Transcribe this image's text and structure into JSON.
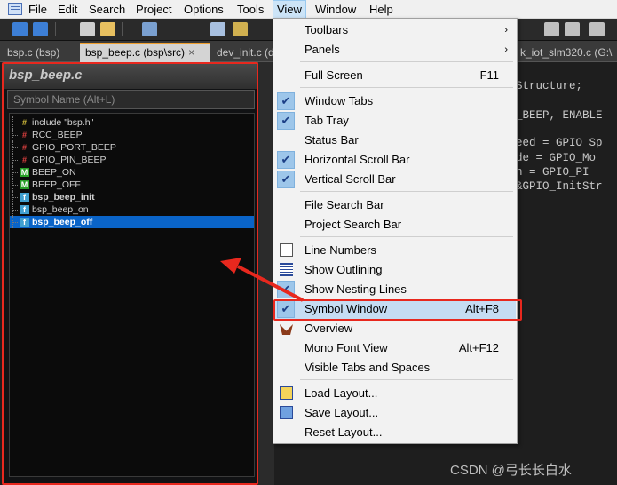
{
  "menubar": {
    "items": [
      {
        "label": "File"
      },
      {
        "label": "Edit"
      },
      {
        "label": "Search"
      },
      {
        "label": "Project"
      },
      {
        "label": "Options"
      },
      {
        "label": "Tools"
      },
      {
        "label": "View"
      },
      {
        "label": "Window"
      },
      {
        "label": "Help"
      }
    ],
    "active_item": "View"
  },
  "tabs": [
    {
      "label": "bsp.c (bsp)",
      "active": false
    },
    {
      "label": "bsp_beep.c (bsp\\src)",
      "active": true
    },
    {
      "label": "dev_init.c (d",
      "active": false
    },
    {
      "label": "k_iot_slm320.c (G:\\",
      "active": false
    }
  ],
  "tab_close_glyph": "×",
  "symbol_window": {
    "title": "bsp_beep.c",
    "search_placeholder": "Symbol Name (Alt+L)",
    "symbols": [
      {
        "label": "include \"bsp.h\"",
        "icon": "include-icon",
        "glyph": "#",
        "bold": false,
        "selected": false
      },
      {
        "label": "RCC_BEEP",
        "icon": "define-icon",
        "glyph": "#",
        "bold": false,
        "selected": false
      },
      {
        "label": "GPIO_PORT_BEEP",
        "icon": "define-icon",
        "glyph": "#",
        "bold": false,
        "selected": false
      },
      {
        "label": "GPIO_PIN_BEEP",
        "icon": "define-icon",
        "glyph": "#",
        "bold": false,
        "selected": false
      },
      {
        "label": "BEEP_ON",
        "icon": "macro-icon",
        "glyph": "M",
        "bold": false,
        "selected": false
      },
      {
        "label": "BEEP_OFF",
        "icon": "macro-icon",
        "glyph": "M",
        "bold": false,
        "selected": false
      },
      {
        "label": "bsp_beep_init",
        "icon": "function-icon",
        "glyph": "f",
        "bold": true,
        "selected": false
      },
      {
        "label": "bsp_beep_on",
        "icon": "function-icon",
        "glyph": "f",
        "bold": false,
        "selected": false
      },
      {
        "label": "bsp_beep_off",
        "icon": "function-icon",
        "glyph": "f",
        "bold": true,
        "selected": true
      }
    ]
  },
  "editor": {
    "lines": [
      {
        "text": "Structure;",
        "color": "#c8c8c8"
      },
      {
        "text": "_BEEP, ENABLE",
        "color": "#e83030"
      },
      {
        "text": "eed = GPIO_Sp",
        "color": "#c8c8c8"
      },
      {
        "text": "de  = GPIO_Mo",
        "color": "#c8c8c8"
      },
      {
        "text": "n   = GPIO_PI",
        "color": "#e83030"
      },
      {
        "text": "&GPIO_InitStr",
        "color": "#c8c8c8"
      }
    ]
  },
  "view_menu": {
    "items": [
      {
        "label": "Toolbars",
        "shortcut": "",
        "submenu": true,
        "checked": false,
        "icon": ""
      },
      {
        "label": "Panels",
        "shortcut": "",
        "submenu": true,
        "checked": false,
        "icon": ""
      },
      {
        "label": "Full Screen",
        "shortcut": "F11",
        "submenu": false,
        "checked": false,
        "icon": ""
      },
      {
        "label": "Window Tabs",
        "shortcut": "",
        "submenu": false,
        "checked": true,
        "icon": ""
      },
      {
        "label": "Tab Tray",
        "shortcut": "",
        "submenu": false,
        "checked": true,
        "icon": ""
      },
      {
        "label": "Status Bar",
        "shortcut": "",
        "submenu": false,
        "checked": false,
        "icon": ""
      },
      {
        "label": "Horizontal Scroll Bar",
        "shortcut": "",
        "submenu": false,
        "checked": true,
        "icon": ""
      },
      {
        "label": "Vertical Scroll Bar",
        "shortcut": "",
        "submenu": false,
        "checked": true,
        "icon": ""
      },
      {
        "label": "File Search Bar",
        "shortcut": "",
        "submenu": false,
        "checked": false,
        "icon": ""
      },
      {
        "label": "Project Search Bar",
        "shortcut": "",
        "submenu": false,
        "checked": false,
        "icon": ""
      },
      {
        "label": "Line Numbers",
        "shortcut": "",
        "submenu": false,
        "checked": false,
        "icon": "line-numbers-icon"
      },
      {
        "label": "Show Outlining",
        "shortcut": "",
        "submenu": false,
        "checked": false,
        "icon": "outlining-icon"
      },
      {
        "label": "Show Nesting Lines",
        "shortcut": "",
        "submenu": false,
        "checked": true,
        "icon": ""
      },
      {
        "label": "Symbol Window",
        "shortcut": "Alt+F8",
        "submenu": false,
        "checked": true,
        "icon": "",
        "highlighted": true
      },
      {
        "label": "Overview",
        "shortcut": "",
        "submenu": false,
        "checked": false,
        "icon": "overview-icon"
      },
      {
        "label": "Mono Font View",
        "shortcut": "Alt+F12",
        "submenu": false,
        "checked": false,
        "icon": ""
      },
      {
        "label": "Visible Tabs and Spaces",
        "shortcut": "",
        "submenu": false,
        "checked": false,
        "icon": ""
      },
      {
        "label": "Load Layout...",
        "shortcut": "",
        "submenu": false,
        "checked": false,
        "icon": "load-layout-icon"
      },
      {
        "label": "Save Layout...",
        "shortcut": "",
        "submenu": false,
        "checked": false,
        "icon": "save-layout-icon"
      },
      {
        "label": "Reset Layout...",
        "shortcut": "",
        "submenu": false,
        "checked": false,
        "icon": ""
      }
    ],
    "check_glyph": "✔",
    "submenu_glyph": "›"
  },
  "watermark": "CSDN @弓长长白水",
  "colors": {
    "annotation_red": "#e8281e",
    "selection_blue": "#0a64c8",
    "check_bg": "#9dc6ea"
  }
}
